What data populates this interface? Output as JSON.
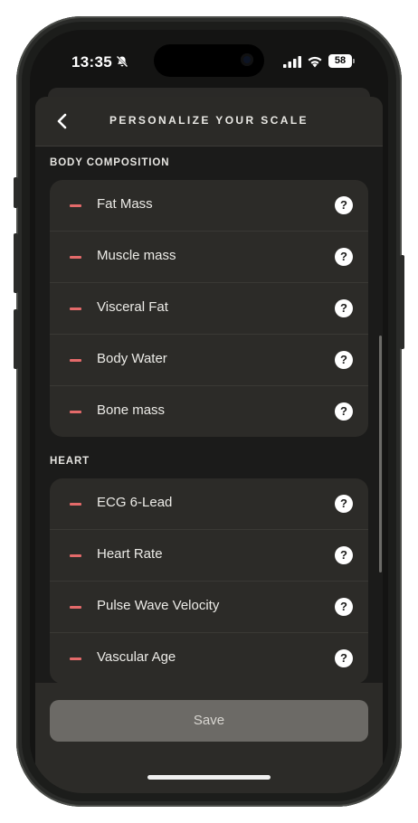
{
  "status_bar": {
    "time": "13:35",
    "battery": "58",
    "icons": [
      "bell-slash-icon",
      "cellular-signal-icon",
      "wifi-icon",
      "battery-icon"
    ]
  },
  "header": {
    "title": "PERSONALIZE YOUR SCALE",
    "back_icon": "chevron-left-icon"
  },
  "sections": [
    {
      "label": "BODY COMPOSITION",
      "items": [
        "Fat Mass",
        "Muscle mass",
        "Visceral Fat",
        "Body Water",
        "Bone mass"
      ]
    },
    {
      "label": "HEART",
      "items": [
        "ECG 6-Lead",
        "Heart Rate",
        "Pulse Wave Velocity",
        "Vascular Age"
      ]
    }
  ],
  "row_icons": {
    "remove": "minus-icon",
    "help": "question-mark-icon",
    "help_glyph": "?"
  },
  "footer": {
    "save_label": "Save"
  },
  "colors": {
    "background": "#1b1b1a",
    "card": "#2c2b28",
    "remove_accent": "#e46a6a",
    "save_button": "#6c6a66"
  }
}
